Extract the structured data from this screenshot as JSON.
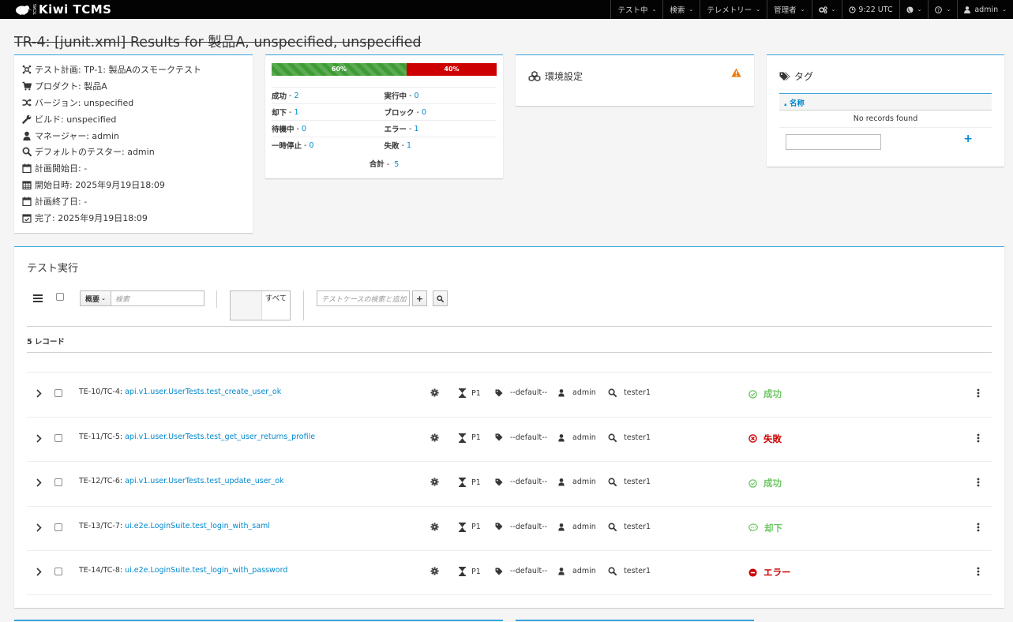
{
  "navbar": {
    "brand": "Kiwi TCMS",
    "brand_small": "TCMS",
    "items": [
      {
        "label": "テスト中"
      },
      {
        "label": "検索"
      },
      {
        "label": "テレメトリー"
      },
      {
        "label": "管理者"
      },
      {
        "label": ""
      },
      {
        "label": "9:22 UTC"
      },
      {
        "label": ""
      },
      {
        "label": ""
      },
      {
        "label": "admin"
      }
    ]
  },
  "title": "TR-4: [junit.xml] Results for 製品A, unspecified, unspecified",
  "info": {
    "plan": "テスト計画: TP-1: 製品Aのスモークテスト",
    "product": "プロダクト: 製品A",
    "version": "バージョン: unspecified",
    "build": "ビルド: unspecified",
    "manager": "マネージャー: admin",
    "tester": "デフォルトのテスター: admin",
    "planned_start": "計画開始日: -",
    "started": "開始日時: 2025年9月19日18:09",
    "planned_stop": "計画終了日: -",
    "finished": "完了: 2025年9月19日18:09"
  },
  "progress": {
    "pass_pct": "60%",
    "fail_pct": "40%",
    "pass_fraction": 0.6,
    "stats": [
      {
        "label": "成功",
        "value": "2"
      },
      {
        "label": "実行中",
        "value": "0"
      },
      {
        "label": "却下",
        "value": "1"
      },
      {
        "label": "ブロック",
        "value": "0"
      },
      {
        "label": "待機中",
        "value": "0"
      },
      {
        "label": "エラー",
        "value": "1"
      },
      {
        "label": "一時停止",
        "value": "0"
      },
      {
        "label": "失敗",
        "value": "1"
      }
    ],
    "total_label": "合計",
    "total_value": "5"
  },
  "environment": {
    "title": "環境設定"
  },
  "tags": {
    "title": "タグ",
    "column": "名称",
    "empty": "No records found",
    "add": "+"
  },
  "executions": {
    "title": "テスト実行",
    "filter_dropdown": "概要",
    "filter_placeholder": "検索",
    "toggle_label": "すべて",
    "tc_search_placeholder": "テストケースの検索と追加",
    "records": "5 レコード",
    "rows": [
      {
        "id": "TE-10/TC-4:",
        "name": "api.v1.user.UserTests.test_create_user_ok",
        "priority": "P1",
        "category": "--default--",
        "assignee": "admin",
        "tester": "tester1",
        "status": "成功",
        "status_kind": "pass",
        "status_color": "#6ec664"
      },
      {
        "id": "TE-11/TC-5:",
        "name": "api.v1.user.UserTests.test_get_user_returns_profile",
        "priority": "P1",
        "category": "--default--",
        "assignee": "admin",
        "tester": "tester1",
        "status": "失敗",
        "status_kind": "fail",
        "status_color": "#cc0000"
      },
      {
        "id": "TE-12/TC-6:",
        "name": "api.v1.user.UserTests.test_update_user_ok",
        "priority": "P1",
        "category": "--default--",
        "assignee": "admin",
        "tester": "tester1",
        "status": "成功",
        "status_kind": "pass",
        "status_color": "#6ec664"
      },
      {
        "id": "TE-13/TC-7:",
        "name": "ui.e2e.LoginSuite.test_login_with_saml",
        "priority": "P1",
        "category": "--default--",
        "assignee": "admin",
        "tester": "tester1",
        "status": "却下",
        "status_kind": "waived",
        "status_color": "#6ec664"
      },
      {
        "id": "TE-14/TC-8:",
        "name": "ui.e2e.LoginSuite.test_login_with_password",
        "priority": "P1",
        "category": "--default--",
        "assignee": "admin",
        "tester": "tester1",
        "status": "エラー",
        "status_kind": "error",
        "status_color": "#cc0000"
      }
    ]
  },
  "colors": {
    "accent": "#39a5dc",
    "link": "#0088ce",
    "pass": "#3f9c35",
    "fail": "#cc0000",
    "warning": "#ec7a08"
  }
}
